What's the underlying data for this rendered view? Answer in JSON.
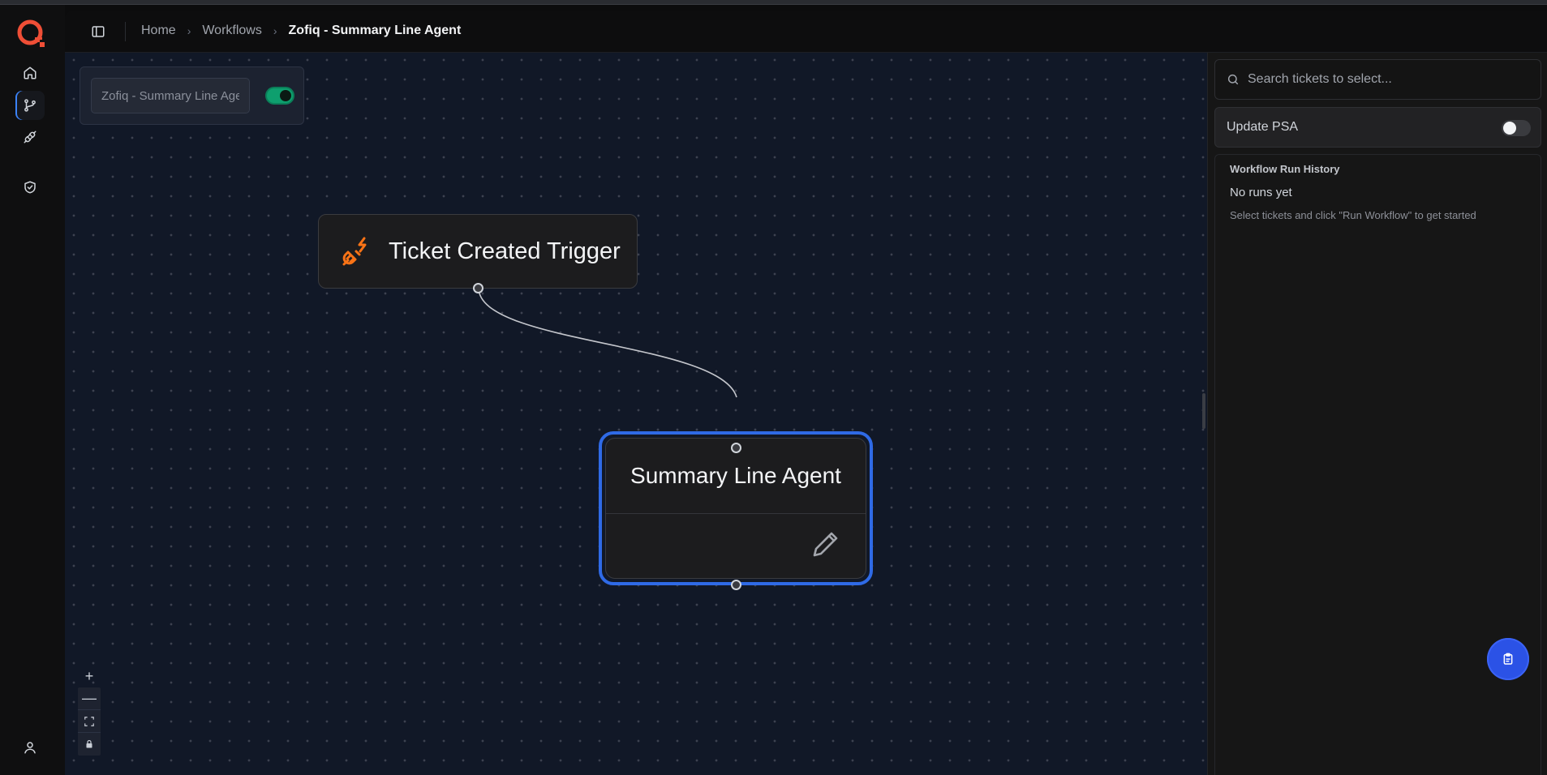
{
  "app": {
    "name": "Zofiq",
    "colors": {
      "accent": "#2f6ae6",
      "trigger_icon": "#f97316",
      "toggle_on": "#0e9f6e",
      "fab": "#2b52e6"
    }
  },
  "nav": {
    "items": [
      {
        "name": "home",
        "icon": "home-icon",
        "active": false
      },
      {
        "name": "workflows",
        "icon": "git-branch-icon",
        "active": true
      },
      {
        "name": "integrations",
        "icon": "plug-icon",
        "active": false
      },
      {
        "name": "security",
        "icon": "shield-check-icon",
        "active": false
      }
    ],
    "profile_icon": "user-icon"
  },
  "breadcrumb": {
    "items": [
      "Home",
      "Workflows"
    ],
    "current": "Zofiq - Summary Line Agent",
    "separator": "›"
  },
  "workflow": {
    "name_value": "Zofiq - Summary Line Agent",
    "enabled": true
  },
  "nodes": {
    "trigger": {
      "title": "Ticket Created Trigger",
      "icon": "plug-lightning-icon"
    },
    "agent": {
      "title": "Summary Line Agent",
      "action_icon": "pencil-icon",
      "selected": true
    }
  },
  "zoom_controls": {
    "zoom_in": "+",
    "zoom_out": "—",
    "fit_view": "fit-view-icon",
    "lock": "lock-icon"
  },
  "panel": {
    "search_placeholder": "Search tickets to select...",
    "update_psa_label": "Update PSA",
    "update_psa_enabled": false,
    "history_title": "Workflow Run History",
    "history_empty": "No runs yet",
    "history_hint": "Select tickets and click \"Run Workflow\" to get started"
  },
  "fab": {
    "icon": "clipboard-icon"
  }
}
